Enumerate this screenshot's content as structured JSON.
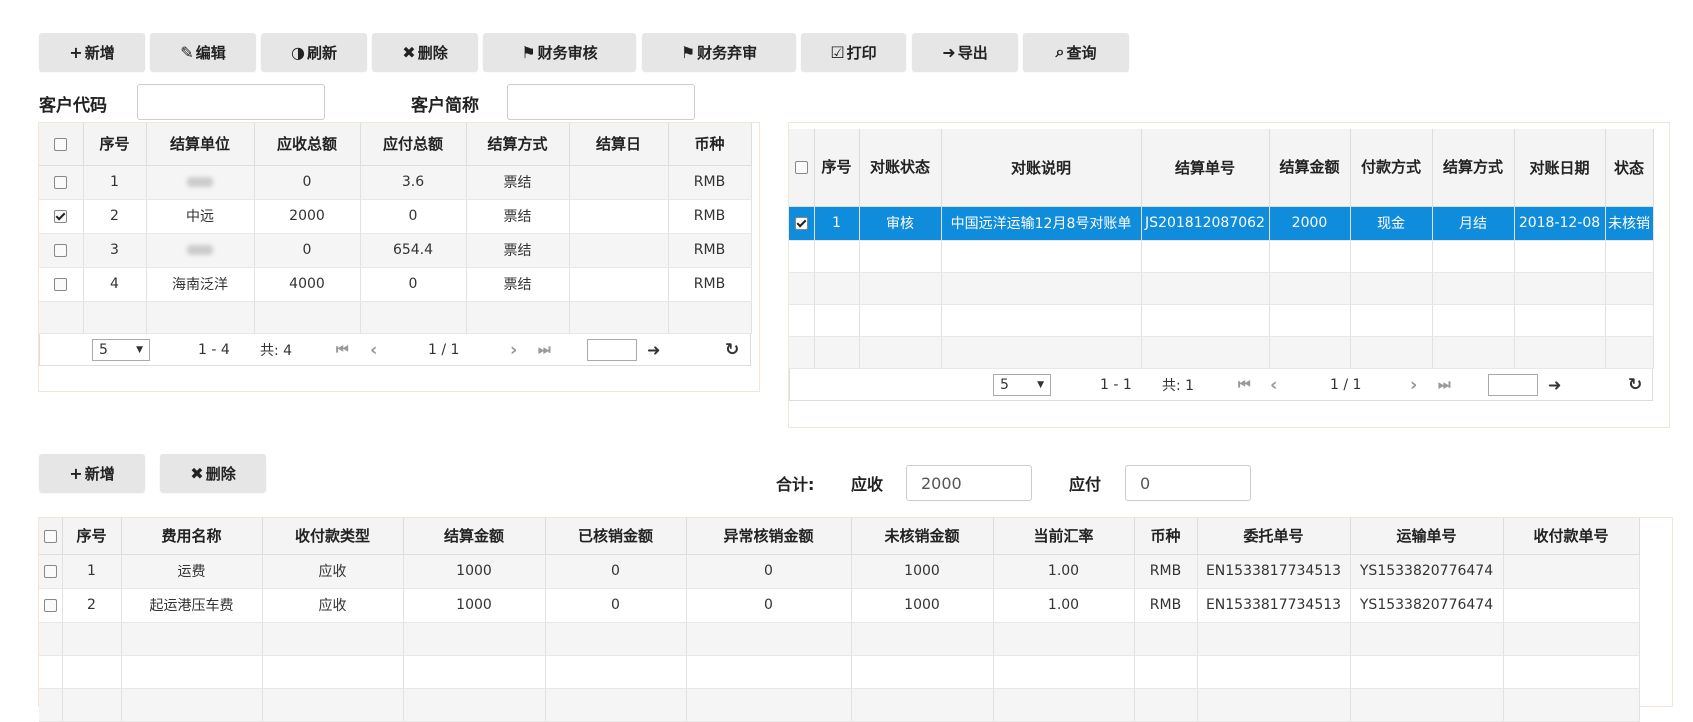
{
  "toolbar_top": [
    {
      "icon": "+",
      "label": "新增"
    },
    {
      "icon": "✎",
      "label": "编辑"
    },
    {
      "icon": "◑",
      "label": "刷新"
    },
    {
      "icon": "✖",
      "label": "删除"
    },
    {
      "icon": "⚑",
      "label": "财务审核"
    },
    {
      "icon": "⚑",
      "label": "财务弃审"
    },
    {
      "icon": "☑",
      "label": "打印"
    },
    {
      "icon": "➜",
      "label": "导出"
    },
    {
      "icon": "⌕",
      "label": "查询"
    }
  ],
  "filters": {
    "customer_code_label": "客户代码",
    "customer_code_value": "",
    "customer_short_label": "客户简称",
    "customer_short_value": ""
  },
  "left_grid": {
    "headers": [
      "序号",
      "结算单位",
      "应收总额",
      "应付总额",
      "结算方式",
      "结算日",
      "币种"
    ],
    "rows": [
      {
        "checked": false,
        "cells": [
          "1",
          "",
          "0",
          "3.6",
          "票结",
          "",
          "RMB"
        ]
      },
      {
        "checked": true,
        "cells": [
          "2",
          "中远",
          "2000",
          "0",
          "票结",
          "",
          "RMB"
        ]
      },
      {
        "checked": false,
        "cells": [
          "3",
          "",
          "0",
          "654.4",
          "票结",
          "",
          "RMB"
        ]
      },
      {
        "checked": false,
        "cells": [
          "4",
          "海南泛洋",
          "4000",
          "0",
          "票结",
          "",
          "RMB"
        ]
      }
    ],
    "pager": {
      "page_size": "5",
      "range": "1 - 4",
      "total": "共: 4",
      "page": "1 / 1"
    }
  },
  "right_grid": {
    "headers": [
      "序号",
      "对账状态",
      "对账说明",
      "结算单号",
      "结算金额",
      "付款方式",
      "结算方式",
      "对账日期",
      "状态"
    ],
    "rows": [
      {
        "checked": true,
        "cells": [
          "1",
          "审核",
          "中国远洋运输12月8号对账单",
          "JS201812087062",
          "2000",
          "现金",
          "月结",
          "2018-12-08",
          "未核销"
        ]
      }
    ],
    "pager": {
      "page_size": "5",
      "range": "1 - 1",
      "total": "共: 1",
      "page": "1 / 1"
    }
  },
  "toolbar_bottom": [
    {
      "icon": "+",
      "label": "新增"
    },
    {
      "icon": "✖",
      "label": "删除"
    }
  ],
  "totals": {
    "label": "合计:",
    "receivable_label": "应收",
    "receivable_value": "2000",
    "payable_label": "应付",
    "payable_value": "0"
  },
  "bottom_grid": {
    "headers": [
      "序号",
      "费用名称",
      "收付款类型",
      "结算金额",
      "已核销金额",
      "异常核销金额",
      "未核销金额",
      "当前汇率",
      "币种",
      "委托单号",
      "运输单号",
      "收付款单号"
    ],
    "rows": [
      {
        "checked": false,
        "cells": [
          "1",
          "运费",
          "应收",
          "1000",
          "0",
          "0",
          "1000",
          "1.00",
          "RMB",
          "EN1533817734513",
          "YS1533820776474",
          ""
        ]
      },
      {
        "checked": false,
        "cells": [
          "2",
          "起运港压车费",
          "应收",
          "1000",
          "0",
          "0",
          "1000",
          "1.00",
          "RMB",
          "EN1533817734513",
          "YS1533820776474",
          ""
        ]
      }
    ]
  },
  "colors": {
    "selected_row": "#0f8ddc",
    "button_bg": "#e6e6e6"
  }
}
